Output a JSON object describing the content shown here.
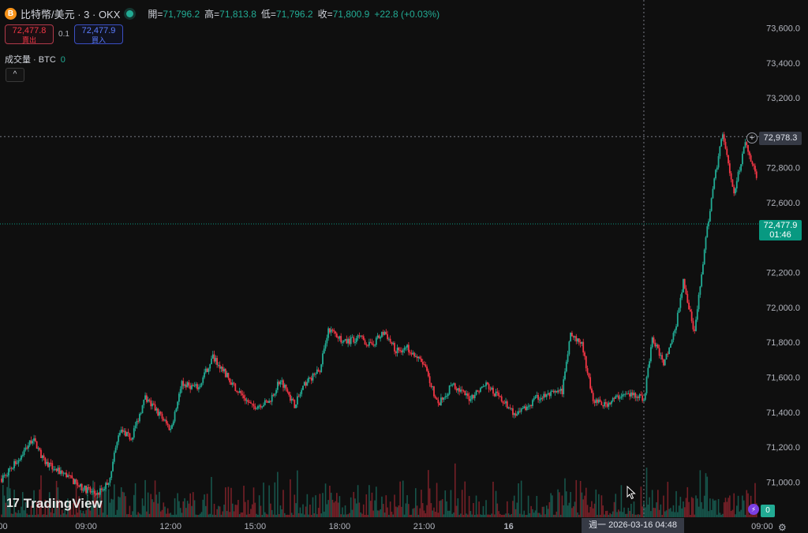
{
  "header": {
    "coin_icon_label": "B",
    "symbol": "比特幣/美元 · 3 · OKX",
    "ohlc": [
      {
        "key": "開=",
        "value": "71,796.2"
      },
      {
        "key": "高=",
        "value": "71,813.8"
      },
      {
        "key": "低=",
        "value": "71,796.2"
      },
      {
        "key": "收=",
        "value": "71,800.9"
      }
    ],
    "change": "+22.8 (+0.03%)"
  },
  "trade": {
    "sell_price": "72,477.8",
    "sell_label": "賣出",
    "spread": "0.1",
    "buy_price": "72,477.9",
    "buy_label": "買入"
  },
  "volume": {
    "label": "成交量 · BTC",
    "value": "0"
  },
  "collapse_glyph": "^",
  "logo": {
    "mark": "17",
    "text": "TradingView"
  },
  "price_axis": {
    "labels": [
      "73,600.0",
      "73,400.0",
      "73,200.0",
      "72,800.0",
      "72,600.0",
      "72,200.0",
      "72,000.0",
      "71,800.0",
      "71,600.0",
      "71,400.0",
      "71,200.0",
      "71,000.0"
    ],
    "crosshair_price": "72,978.3",
    "last_price": "72,477.9",
    "countdown": "01:46"
  },
  "time_axis": {
    "labels": [
      {
        "t": "06:00",
        "text": ":00"
      },
      {
        "t": "09:00",
        "text": "09:00"
      },
      {
        "t": "12:00",
        "text": "12:00"
      },
      {
        "t": "15:00",
        "text": "15:00"
      },
      {
        "t": "18:00",
        "text": "18:00"
      },
      {
        "t": "21:00",
        "text": "21:00"
      },
      {
        "t": "24:00",
        "text": "16"
      },
      {
        "t": "27:00",
        "text": "03"
      },
      {
        "t": "33:00",
        "text": "09:00"
      }
    ],
    "crosshair_time": "週一 2026-03-16  04:48"
  },
  "volume_axis": {
    "value": "0"
  },
  "colors": {
    "up": "#22ab94",
    "down": "#f23645",
    "background": "#0f0f0f",
    "grid": "#1b1b1b"
  },
  "icons": {
    "crosshair_add": "plus-circle-icon",
    "indicator": "lightning-icon",
    "settings": "gear-icon",
    "pointer": "mouse-cursor-icon"
  },
  "chart_data": {
    "type": "candlestick",
    "interval_minutes": 3,
    "x_unit": "hours",
    "ylim": [
      70900,
      73700
    ],
    "anchors": [
      {
        "t": 6.0,
        "p": 71020
      },
      {
        "t": 6.6,
        "p": 71130
      },
      {
        "t": 7.1,
        "p": 71250
      },
      {
        "t": 7.5,
        "p": 71120
      },
      {
        "t": 7.9,
        "p": 71070
      },
      {
        "t": 8.3,
        "p": 71040
      },
      {
        "t": 8.8,
        "p": 70970
      },
      {
        "t": 9.4,
        "p": 70930
      },
      {
        "t": 9.8,
        "p": 71000
      },
      {
        "t": 10.2,
        "p": 71300
      },
      {
        "t": 10.6,
        "p": 71250
      },
      {
        "t": 11.1,
        "p": 71480
      },
      {
        "t": 11.6,
        "p": 71390
      },
      {
        "t": 12.0,
        "p": 71300
      },
      {
        "t": 12.4,
        "p": 71560
      },
      {
        "t": 13.0,
        "p": 71540
      },
      {
        "t": 13.5,
        "p": 71720
      },
      {
        "t": 14.2,
        "p": 71560
      },
      {
        "t": 14.9,
        "p": 71430
      },
      {
        "t": 15.5,
        "p": 71460
      },
      {
        "t": 15.9,
        "p": 71590
      },
      {
        "t": 16.4,
        "p": 71440
      },
      {
        "t": 16.8,
        "p": 71570
      },
      {
        "t": 17.3,
        "p": 71640
      },
      {
        "t": 17.6,
        "p": 71880
      },
      {
        "t": 18.2,
        "p": 71800
      },
      {
        "t": 18.7,
        "p": 71830
      },
      {
        "t": 19.1,
        "p": 71780
      },
      {
        "t": 19.6,
        "p": 71860
      },
      {
        "t": 20.0,
        "p": 71750
      },
      {
        "t": 20.4,
        "p": 71770
      },
      {
        "t": 21.0,
        "p": 71670
      },
      {
        "t": 21.5,
        "p": 71440
      },
      {
        "t": 22.0,
        "p": 71560
      },
      {
        "t": 22.6,
        "p": 71480
      },
      {
        "t": 23.2,
        "p": 71560
      },
      {
        "t": 23.8,
        "p": 71460
      },
      {
        "t": 24.3,
        "p": 71380
      },
      {
        "t": 25.0,
        "p": 71480
      },
      {
        "t": 25.9,
        "p": 71520
      },
      {
        "t": 26.2,
        "p": 71840
      },
      {
        "t": 26.6,
        "p": 71790
      },
      {
        "t": 27.0,
        "p": 71470
      },
      {
        "t": 27.4,
        "p": 71440
      },
      {
        "t": 28.0,
        "p": 71500
      },
      {
        "t": 28.6,
        "p": 71500
      },
      {
        "t": 28.8,
        "p": 71470
      },
      {
        "t": 29.1,
        "p": 71820
      },
      {
        "t": 29.5,
        "p": 71680
      },
      {
        "t": 29.9,
        "p": 71860
      },
      {
        "t": 30.2,
        "p": 72150
      },
      {
        "t": 30.6,
        "p": 71850
      },
      {
        "t": 30.9,
        "p": 72260
      },
      {
        "t": 31.2,
        "p": 72630
      },
      {
        "t": 31.6,
        "p": 73000
      },
      {
        "t": 32.0,
        "p": 72650
      },
      {
        "t": 32.4,
        "p": 72950
      },
      {
        "t": 32.8,
        "p": 72750
      },
      {
        "t": 33.1,
        "p": 72630
      },
      {
        "t": 33.3,
        "p": 72580
      },
      {
        "t": 33.5,
        "p": 72480
      }
    ],
    "volume_max_btc": 0.0
  }
}
